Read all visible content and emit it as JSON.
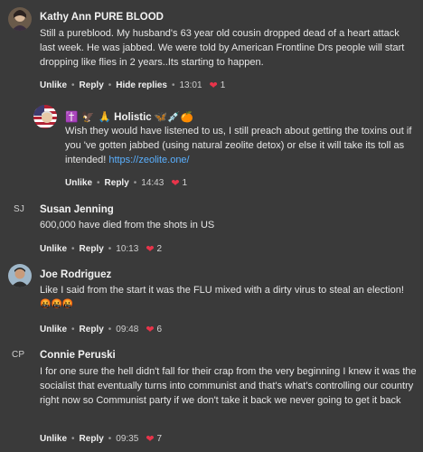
{
  "comments": [
    {
      "author": "Kathy Ann PURE BLOOD",
      "text": "Still a pureblood. My husband's 63 year old cousin dropped dead of a heart attack last week. He was jabbed. We were told by American Frontline Drs people will start dropping like flies in 2 years..Its starting to happen.",
      "actions": {
        "unlike": "Unlike",
        "reply": "Reply",
        "hide": "Hide replies",
        "time": "13:01",
        "likes": "1"
      }
    },
    {
      "author_prefix": "✝️ 🦅 🙏",
      "author": "Holistic",
      "author_suffix": "🦋💉🍊",
      "text": "Wish they would have listened to us, I still preach about getting the toxins out if you 've gotten jabbed (using natural zeolite detox) or else it will take its toll as intended! ",
      "link": "https://zeolite.one/",
      "actions": {
        "unlike": "Unlike",
        "reply": "Reply",
        "time": "14:43",
        "likes": "1"
      }
    },
    {
      "initials": "SJ",
      "author": "Susan Jenning",
      "text": "600,000 have died from the shots in US",
      "actions": {
        "unlike": "Unlike",
        "reply": "Reply",
        "time": "10:13",
        "likes": "2"
      }
    },
    {
      "author": "Joe Rodriguez",
      "text": "Like I said from the start it was the FLU mixed with a dirty virus to steal an election!",
      "emoji_line": "🤬🤬🤬",
      "actions": {
        "unlike": "Unlike",
        "reply": "Reply",
        "time": "09:48",
        "likes": "6"
      }
    },
    {
      "initials": "CP",
      "author": "Connie Peruski",
      "text": "I for one sure the hell didn't fall for their crap from the very beginning I knew it was the socialist that eventually turns into communist and that's what's controlling our country right now so Communist party if we don't take it back we never going to get it back",
      "actions": {
        "unlike": "Unlike",
        "reply": "Reply",
        "time": "09:35",
        "likes": "7"
      }
    }
  ],
  "icons": {
    "heart": "heart-icon",
    "dot": "•"
  },
  "colors": {
    "background": "#3a3a3a",
    "heart": "#e8344a",
    "link": "#5ab0ff"
  }
}
